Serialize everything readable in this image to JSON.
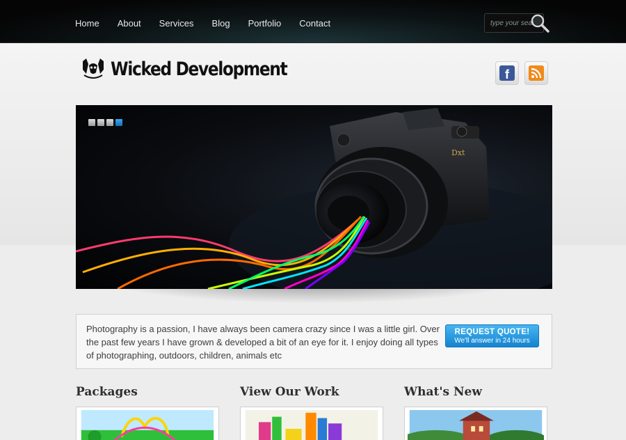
{
  "nav": {
    "items": [
      "Home",
      "About",
      "Services",
      "Blog",
      "Portfolio",
      "Contact"
    ]
  },
  "search": {
    "placeholder": "type your search"
  },
  "logo": {
    "text": "Wicked Development"
  },
  "social": {
    "facebook_glyph": "f"
  },
  "slider": {
    "dot_count": 4,
    "active_dot": 4
  },
  "quote": {
    "text": "Photography is a passion, I have always been camera crazy since I was a little girl. Over the past few years I have grown & developed a bit of an eye for it. I enjoy doing all types of photographing, outdoors, children, animals etc",
    "button_title": "REQUEST QUOTE!",
    "button_subtitle": "We'll answer in 24 hours"
  },
  "columns": [
    {
      "title": "Packages"
    },
    {
      "title": "View Our Work"
    },
    {
      "title": "What's New"
    }
  ],
  "colors": {
    "accent": "#1583cf",
    "nav_bg": "#050505",
    "page_bg": "#ededed"
  }
}
